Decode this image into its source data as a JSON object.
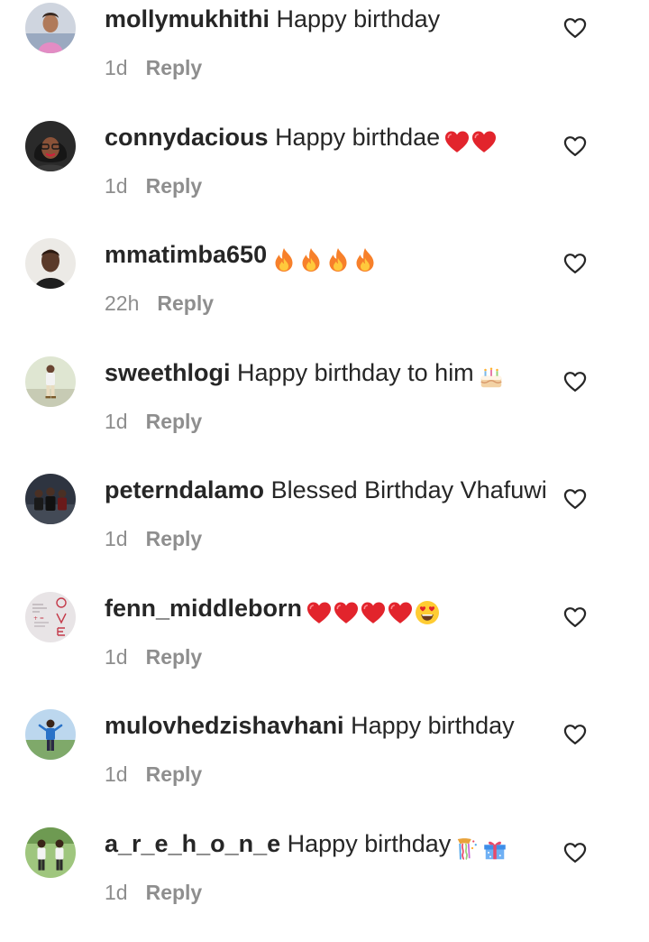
{
  "comments": [
    {
      "username": "mollymukhithi",
      "text": "Happy birthday",
      "emojis": [],
      "time": "1d",
      "reply_label": "Reply",
      "avatar_icon": "woman-portrait-avatar"
    },
    {
      "username": "connydacious",
      "text": "Happy birthdae",
      "emojis": [
        "red-heart",
        "red-heart"
      ],
      "time": "1d",
      "reply_label": "Reply",
      "avatar_icon": "woman-glasses-avatar"
    },
    {
      "username": "mmatimba650",
      "text": "",
      "emojis": [
        "fire",
        "fire",
        "fire",
        "fire"
      ],
      "time": "22h",
      "reply_label": "Reply",
      "avatar_icon": "man-portrait-avatar"
    },
    {
      "username": "sweethlogi",
      "text": "Happy birthday to him",
      "emojis": [
        "birthday-cake"
      ],
      "time": "1d",
      "reply_label": "Reply",
      "avatar_icon": "standing-person-avatar"
    },
    {
      "username": "peterndalamo",
      "text": "Blessed Birthday Vhafuwi",
      "emojis": [],
      "time": "1d",
      "reply_label": "Reply",
      "avatar_icon": "group-photo-avatar"
    },
    {
      "username": "fenn_middleborn",
      "text": "",
      "emojis": [
        "red-heart",
        "red-heart",
        "red-heart",
        "red-heart",
        "heart-eyes-face"
      ],
      "time": "1d",
      "reply_label": "Reply",
      "avatar_icon": "love-sketch-avatar"
    },
    {
      "username": "mulovhedzishavhani",
      "text": "Happy birthday",
      "emojis": [],
      "time": "1d",
      "reply_label": "Reply",
      "avatar_icon": "outdoor-person-avatar"
    },
    {
      "username": "a_r_e_h_o_n_e",
      "text": "Happy birthday",
      "emojis": [
        "confetti-ball",
        "wrapped-gift"
      ],
      "time": "1d",
      "reply_label": "Reply",
      "avatar_icon": "group-outdoor-avatar"
    }
  ],
  "icons": {
    "like": "heart-outline-icon"
  },
  "colors": {
    "text": "#262626",
    "secondary_text": "#8e8e8e",
    "heart_red": "#e2242c",
    "fire_orange": "#f7802a",
    "background": "#ffffff"
  }
}
